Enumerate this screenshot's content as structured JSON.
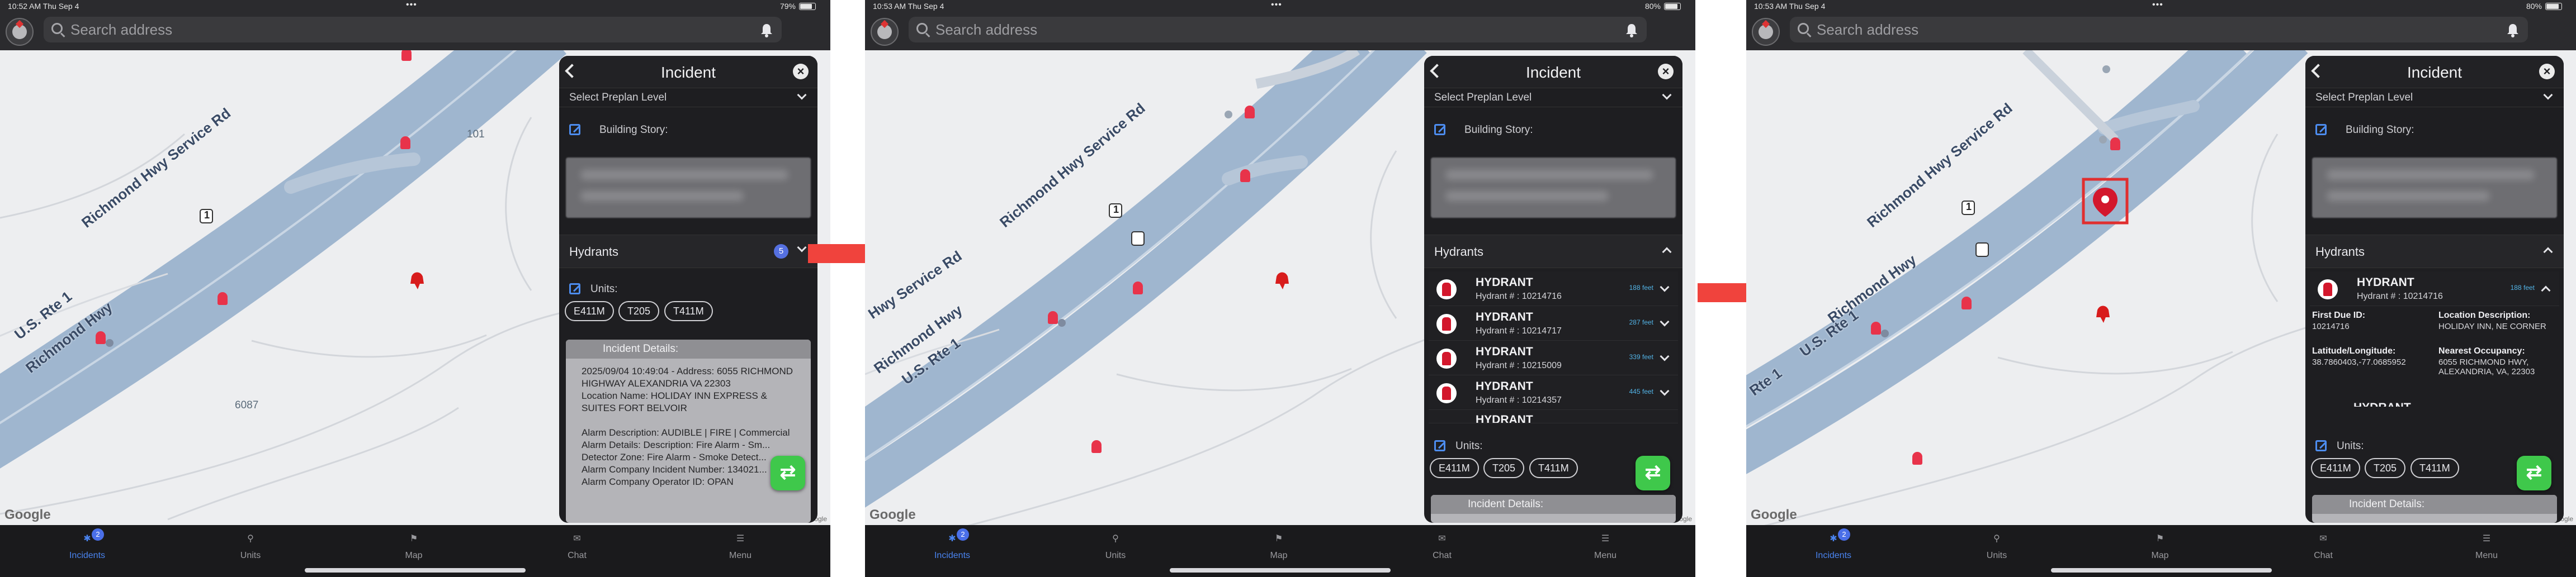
{
  "app": {
    "search_placeholder": "Search address",
    "tabs": [
      {
        "label": "Incidents",
        "badge": "2"
      },
      {
        "label": "Units"
      },
      {
        "label": "Map"
      },
      {
        "label": "Chat"
      },
      {
        "label": "Menu"
      }
    ],
    "google_label": "Google",
    "copyright": "©2025 Google"
  },
  "screens": [
    {
      "time": "10:52 AM  Thu Sep 4",
      "battery": "79%",
      "map_labels": {
        "service_rd": "Richmond Hwy Service Rd",
        "us_rte": "U.S. Rte 1",
        "richmond_hwy": "Richmond Hwy",
        "shield": "1",
        "num_101": "101",
        "num_6087": "6087"
      }
    },
    {
      "time": "10:53 AM  Thu Sep 4",
      "battery": "80%",
      "map_labels": {
        "service_rd": "Richmond Hwy Service Rd",
        "hwy_service": "Hwy Service Rd",
        "us_rte": "U.S. Rte 1",
        "richmond_hwy": "Richmond Hwy",
        "shield": "1"
      }
    },
    {
      "time": "10:53 AM  Thu Sep 4",
      "battery": "80%",
      "map_labels": {
        "service_rd": "Richmond Hwy Service Rd",
        "us_rte": "U.S. Rte 1",
        "richmond_hwy": "Richmond Hwy",
        "rte1": "Rte 1",
        "shield": "1"
      }
    }
  ],
  "panel": {
    "title": "Incident",
    "preplan": "Select Preplan Level",
    "building_story": "Building Story:",
    "hydrants_label": "Hydrants",
    "hydrants_count": "5",
    "units_label": "Units:",
    "units": [
      "E411M",
      "T205",
      "T411M"
    ],
    "incident_details_label": "Incident Details:",
    "incident_details_text": "2025/09/04 10:49:04 - Address: 6055 RICHMOND HIGHWAY ALEXANDRIA VA 22303\nLocation Name: HOLIDAY INN EXPRESS & SUITES FORT BELVOIR\n\nAlarm Description: AUDIBLE | FIRE | Commercial\nAlarm Details: Description: Fire Alarm - Sm...\nDetector Zone: Fire Alarm - Smoke Detect...\nAlarm Company Incident Number: 134021...\nAlarm Company Operator ID: OPAN",
    "hydrants": [
      {
        "name": "HYDRANT",
        "number": "Hydrant # : 10214716",
        "distance": "188 feet"
      },
      {
        "name": "HYDRANT",
        "number": "Hydrant # : 10214717",
        "distance": "287 feet"
      },
      {
        "name": "HYDRANT",
        "number": "Hydrant # : 10215009",
        "distance": "339 feet"
      },
      {
        "name": "HYDRANT",
        "number": "Hydrant # : 10214357",
        "distance": "445 feet"
      }
    ],
    "hydrant_partial": "HYDRANT",
    "expanded": {
      "name": "HYDRANT",
      "number": "Hydrant # : 10214716",
      "distance": "188 feet",
      "first_due_label": "First Due ID:",
      "first_due_value": "10214716",
      "location_desc_label": "Location Description:",
      "location_desc_value": "HOLIDAY INN, NE CORNER",
      "latlon_label": "Latitude/Longitude:",
      "latlon_value": "38.7860403,-77.0685952",
      "nearest_label": "Nearest Occupancy:",
      "nearest_value": "6055 RICHMOND HWY, ALEXANDRIA, VA, 22303",
      "next_partial": "HYDRANT"
    }
  },
  "colors": {
    "accent": "#4a84f0",
    "hydrant_red": "#d3172c",
    "arrow_red": "#f0433d",
    "fab_green": "#3fc84b",
    "road_blue": "#9fb6cf"
  }
}
